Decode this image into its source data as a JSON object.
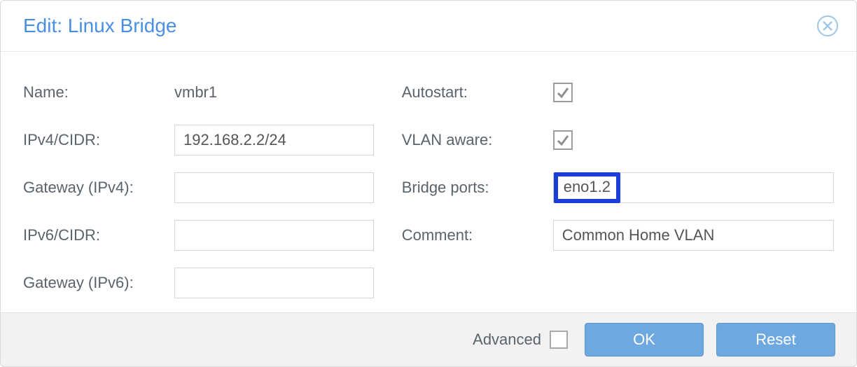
{
  "dialog": {
    "title": "Edit: Linux Bridge"
  },
  "left": {
    "name_label": "Name:",
    "name_value": "vmbr1",
    "ipv4_label": "IPv4/CIDR:",
    "ipv4_value": "192.168.2.2/24",
    "gw4_label": "Gateway (IPv4):",
    "gw4_value": "",
    "ipv6_label": "IPv6/CIDR:",
    "ipv6_value": "",
    "gw6_label": "Gateway (IPv6):",
    "gw6_value": ""
  },
  "right": {
    "autostart_label": "Autostart:",
    "autostart_checked": true,
    "vlan_label": "VLAN aware:",
    "vlan_checked": true,
    "bridge_label": "Bridge ports:",
    "bridge_value": "eno1.2",
    "comment_label": "Comment:",
    "comment_value": "Common Home VLAN"
  },
  "footer": {
    "advanced_label": "Advanced",
    "advanced_checked": false,
    "ok_label": "OK",
    "reset_label": "Reset"
  }
}
